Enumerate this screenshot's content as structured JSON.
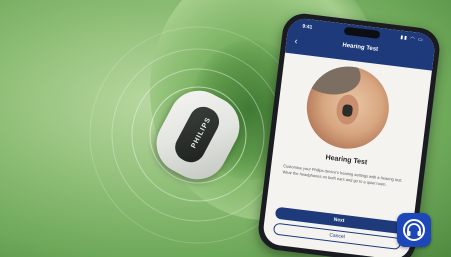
{
  "earbud": {
    "brand": "PHILIPS"
  },
  "phone": {
    "status_time": "9:41",
    "status_icons": "▮▮ ◠ ▭",
    "header_title": "Hearing Test",
    "content_title": "Hearing Test",
    "content_description": "Customise your Philips device's hearing settings with a hearing test. Wear the headphones on both ears and go to a quiet room.",
    "next_label": "Next",
    "cancel_label": "Cancel"
  },
  "colors": {
    "background": "#7fb36a",
    "app_blue": "#1f3a7a",
    "app_icon": "#1d47b8"
  },
  "icons": {
    "back": "chevron-left-icon",
    "app": "headphones-icon"
  }
}
